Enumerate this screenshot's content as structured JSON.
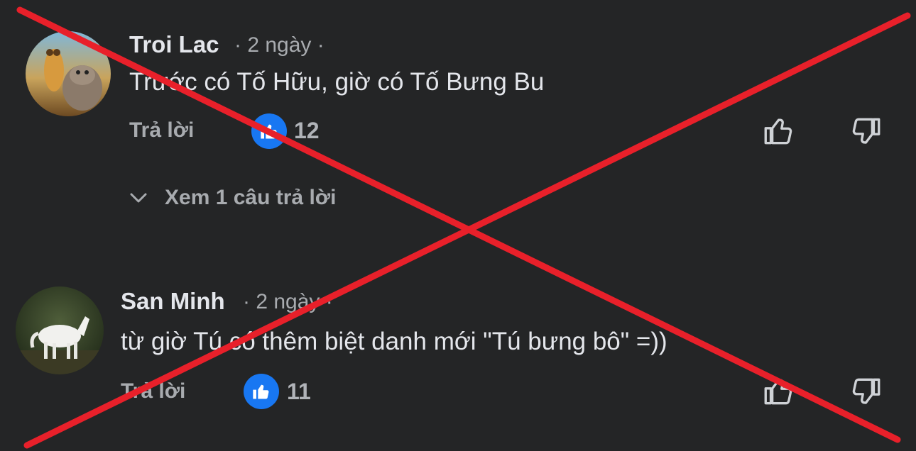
{
  "comments": [
    {
      "author": "Troi Lac",
      "time": "· 2 ngày ·",
      "text": "Trước có Tố Hữu, giờ có Tố Bưng Bu",
      "reply_label": "Trả lời",
      "likes": "12",
      "view_replies_label": "Xem 1 câu trả lời"
    },
    {
      "author": "San Minh",
      "time": "· 2 ngày ·",
      "text": "từ giờ Tú có thêm biệt danh mới \"Tú bưng bô\" =))",
      "reply_label": "Trả lời",
      "likes": "11"
    }
  ],
  "icons": {
    "like_badge": "thumbs-up-icon",
    "like_action": "thumbs-up-outline-icon",
    "dislike_action": "thumbs-down-outline-icon",
    "expand": "chevron-down-icon"
  },
  "colors": {
    "background": "#242526",
    "like_blue": "#1877f2",
    "cross_red": "#e8202a"
  }
}
